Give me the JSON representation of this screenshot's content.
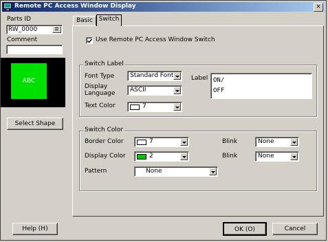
{
  "window": {
    "title": "Remote PC Access Window Display",
    "close_glyph": "×"
  },
  "left": {
    "parts_id_label": "Parts ID",
    "parts_id_value": "RW_0000",
    "comment_label": "Comment",
    "comment_value": "",
    "preview_text": "ABC",
    "select_shape_label": "Select Shape"
  },
  "tabs": [
    {
      "label": "Basic"
    },
    {
      "label": "Switch"
    }
  ],
  "switch_tab": {
    "use_checkbox_label": "Use Remote PC Access Window Switch",
    "use_checkbox_checked": true,
    "switch_label_group": {
      "title": "Switch Label",
      "font_type_label": "Font Type",
      "font_type_value": "Standard Font",
      "display_language_label_line1": "Display",
      "display_language_label_line2": "Language",
      "display_language_value": "ASCII",
      "text_color_label": "Text Color",
      "text_color_value": "7",
      "text_color_swatch": "#ffffff",
      "label_label": "Label",
      "label_line1": "ON/",
      "label_line2": "OFF"
    },
    "switch_color_group": {
      "title": "Switch Color",
      "border_color_label": "Border Color",
      "border_color_value": "7",
      "border_color_swatch": "#ffffff",
      "display_color_label": "Display Color",
      "display_color_value": "2",
      "display_color_swatch": "#00c800",
      "pattern_label": "Pattern",
      "pattern_value": "None",
      "blink1_label": "Blink",
      "blink1_value": "None",
      "blink2_label": "Blink",
      "blink2_value": "None"
    }
  },
  "footer": {
    "help_label": "Help (H)",
    "ok_label": "OK (O)",
    "cancel_label": "Cancel"
  },
  "colors": {
    "preview_bg": "#000000",
    "preview_fill": "#00e000",
    "title_start": "#0a246a"
  }
}
